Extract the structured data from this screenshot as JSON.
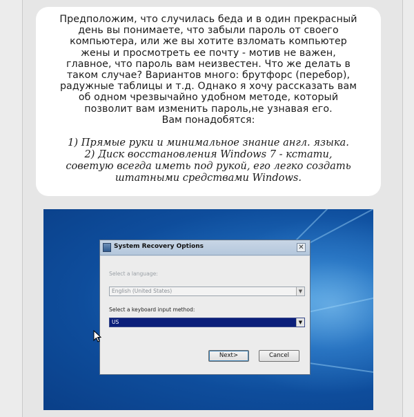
{
  "article": {
    "intro": "Предположим, что случилась беда и в один прекрасный\nдень вы понимаете, что забыли пароль от своего\nкомпьютера, или же вы хотите взломать компьютер\nжены и просмотреть ее почту - мотив не важен,\nглавное, что пароль вам неизвестен. Что же делать в\nтаком случае? Вариантов много: брутфорс (перебор),\nрадужные таблицы и т.д. Однако я хочу рассказать вам\nоб одном чрезвычайно удобном методе, который\nпозволит вам изменить пароль,не узнавая его.",
    "needs": "Вам понадобятся:",
    "list": "1) Прямые руки и минимальное знание англ. языка.\n2) Диск восстановления Windows 7 - кстати,\nсоветую всегда иметь под рукой, его легко создать\nштатными средствами Windows."
  },
  "dialog": {
    "title": "System Recovery Options",
    "close_glyph": "✕",
    "language_label": "Select a language:",
    "language_value": "English (United States)",
    "keyboard_label": "Select a keyboard input method:",
    "keyboard_value": "US",
    "arrow_glyph": "▼",
    "next_label": "Next>",
    "cancel_label": "Cancel"
  },
  "colors": {
    "desktop": "#1d68b8",
    "selected_input": "#0b1f7a",
    "card": "#ffffff"
  }
}
